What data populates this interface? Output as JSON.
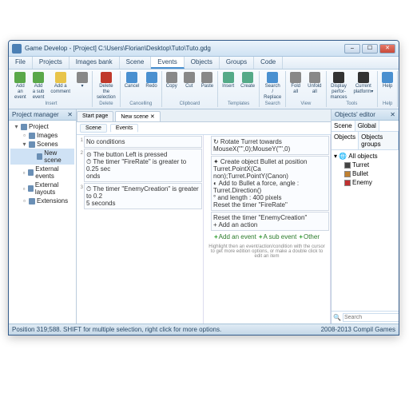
{
  "title": "Game Develop - [Project] C:\\Users\\Florian\\Desktop\\Tuto\\Tuto.gdg",
  "menu": [
    "File",
    "Projects",
    "Images bank",
    "Scene",
    "Events",
    "Objects",
    "Groups",
    "Code"
  ],
  "menu_active": 4,
  "ribbon": {
    "groups": [
      {
        "label": "Insert",
        "items": [
          {
            "l": "Add an event",
            "c": "#5aa84a"
          },
          {
            "l": "Add a sub event",
            "c": "#5aa84a"
          },
          {
            "l": "Add a comment",
            "c": "#e8c44a"
          },
          {
            "l": "▾",
            "c": "#888"
          }
        ]
      },
      {
        "label": "Delete",
        "items": [
          {
            "l": "Delete the selection",
            "c": "#c0392b"
          }
        ]
      },
      {
        "label": "Cancelling",
        "items": [
          {
            "l": "Cancel",
            "c": "#4a90d0"
          },
          {
            "l": "Redo",
            "c": "#4a90d0"
          }
        ]
      },
      {
        "label": "Clipboard",
        "items": [
          {
            "l": "Copy",
            "c": "#888"
          },
          {
            "l": "Cut",
            "c": "#888"
          },
          {
            "l": "Paste",
            "c": "#888"
          }
        ]
      },
      {
        "label": "Templates",
        "items": [
          {
            "l": "Insert",
            "c": "#5a8"
          },
          {
            "l": "Create",
            "c": "#5a8"
          }
        ]
      },
      {
        "label": "Search",
        "items": [
          {
            "l": "Search / Replace",
            "c": "#4a90d0"
          }
        ]
      },
      {
        "label": "View",
        "items": [
          {
            "l": "Fold all",
            "c": "#888"
          },
          {
            "l": "Unfold all",
            "c": "#888"
          }
        ]
      },
      {
        "label": "Tools",
        "items": [
          {
            "l": "Display perfor-mances",
            "c": "#333"
          },
          {
            "l": "Current platform▾",
            "c": "#333"
          }
        ]
      },
      {
        "label": "Help",
        "items": [
          {
            "l": "Help",
            "c": "#4a90d0"
          }
        ]
      }
    ]
  },
  "project_tree": {
    "header": "Project manager",
    "root": "Project",
    "items": [
      {
        "l": "Images",
        "indent": 1,
        "ex": "▫"
      },
      {
        "l": "Scenes",
        "indent": 1,
        "ex": "▾"
      },
      {
        "l": "New scene",
        "indent": 2,
        "sel": true
      },
      {
        "l": "External events",
        "indent": 1,
        "ex": "▫"
      },
      {
        "l": "External layouts",
        "indent": 1,
        "ex": "▫"
      },
      {
        "l": "Extensions",
        "indent": 1,
        "ex": "▫"
      }
    ]
  },
  "center": {
    "tabs": [
      "Start page",
      "New scene  ✕"
    ],
    "tabs_active": 1,
    "subtabs": [
      "Scene",
      "Events"
    ],
    "subtabs_active": 1,
    "events_left": [
      {
        "n": "1",
        "lines": [
          "No conditions"
        ]
      },
      {
        "n": "2",
        "lines": [
          "⊙ The button Left is pressed",
          "⏱ The timer \"FireRate\" is greater to 0.25 sec",
          "  onds"
        ]
      },
      {
        "n": "3",
        "lines": [
          "⏱ The timer \"EnemyCreation\" is greater to 0.2",
          "  5 seconds"
        ]
      }
    ],
    "events_right": [
      {
        "lines": [
          "↻ Rotate Turret towards MouseX(\"\",0);MouseY(\"\",0)"
        ]
      },
      {
        "lines": [
          "✦ Create object Bullet at position Turret.PointX(Ca",
          "  non);Turret.PointY(Canon)",
          "◐ Add to Bullet a force, angle : Turret.Direction()",
          "  ° and length : 400 pixels",
          "  Reset the timer \"FireRate\""
        ]
      },
      {
        "lines": [
          "  Reset the timer \"EnemyCreation\"",
          "+ Add an action"
        ]
      }
    ],
    "addbtns": [
      "Add an event",
      "A sub event",
      "Other"
    ],
    "hint": "Highlight then an event/action/condition with the cursor to get more edition options,\nor make a double click to edit an item"
  },
  "objects": {
    "header": "Objects' editor",
    "toptabs": [
      "Scene",
      "Global"
    ],
    "toptabs_active": 0,
    "subtabs": [
      "Objects",
      "Objects groups"
    ],
    "subtabs_active": 0,
    "root": "All objects",
    "items": [
      {
        "l": "Turret",
        "c": "#444"
      },
      {
        "l": "Bullet",
        "c": "#c08030"
      },
      {
        "l": "Enemy",
        "c": "#c03030"
      }
    ],
    "search_ph": "Search"
  },
  "status": {
    "left": "Position 319;588. SHIFT for multiple selection, right click for more options.",
    "right": "2008-2013 Compil Games"
  }
}
